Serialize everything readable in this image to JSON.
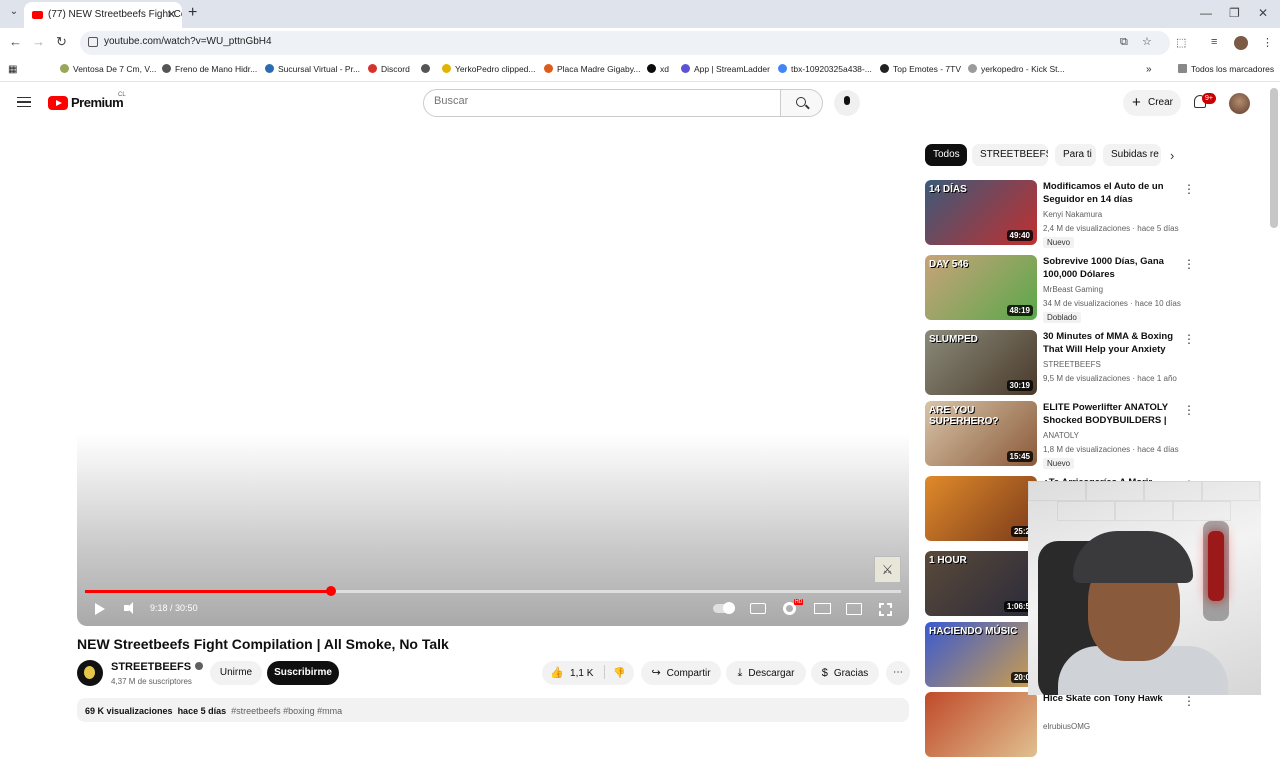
{
  "browser": {
    "tab_title": "(77) NEW Streetbeefs Fight Com",
    "url": "youtube.com/watch?v=WU_pttnGbH4",
    "bookmarks": [
      {
        "label": "Ventosa De 7 Cm, V...",
        "color": "#9aa65a"
      },
      {
        "label": "Freno de Mano Hidr...",
        "color": "#555555"
      },
      {
        "label": "Sucursal Virtual - Pr...",
        "color": "#2b6cb0"
      },
      {
        "label": "Discord",
        "color": "#d6332c"
      },
      {
        "label": "",
        "color": "#555555"
      },
      {
        "label": "YerkoPedro clipped...",
        "color": "#e0b400"
      },
      {
        "label": "Placa Madre Gigaby...",
        "color": "#e05a1c"
      },
      {
        "label": "xd",
        "color": "#0c0c0c"
      },
      {
        "label": "App | StreamLadder",
        "color": "#5b52d6"
      },
      {
        "label": "tbx-10920325a438-...",
        "color": "#4285f4"
      },
      {
        "label": "Top Emotes - 7TV",
        "color": "#222222"
      },
      {
        "label": "yerkopedro - Kick St...",
        "color": "#9b9b9b"
      }
    ],
    "all_bookmarks": "Todos los marcadores"
  },
  "header": {
    "brand": "Premium",
    "country": "CL",
    "search_placeholder": "Buscar",
    "create_label": "Crear",
    "notif_count": "9+"
  },
  "player": {
    "current_time": "9:18",
    "duration": "30:50",
    "progress": 0.302,
    "logo_glyph": "⚔"
  },
  "video": {
    "title": "NEW Streetbeefs Fight Compilation | All Smoke, No Talk",
    "channel": "STREETBEEFS",
    "subscribers": "4,37 M de suscriptores",
    "join_label": "Unirme",
    "subscribe_label": "Suscribirme",
    "likes": "1,1 K",
    "share_label": "Compartir",
    "download_label": "Descargar",
    "thanks_label": "Gracias",
    "views": "69 K visualizaciones",
    "age": "hace 5 días",
    "tags": "#streetbeefs #boxing #mma"
  },
  "chips": [
    "Todos",
    "STREETBEEFS",
    "Para ti",
    "Subidas re"
  ],
  "recommendations": [
    {
      "title": "Modificamos el Auto de un Seguidor en 14 días",
      "channel": "Kenyi Nakamura",
      "meta": "2,4 M de visualizaciones · hace 5 días",
      "tag": "Nuevo",
      "duration": "49:40",
      "badge": "14 DÍAS",
      "c1": "#3b5a7a",
      "c2": "#c22f2f"
    },
    {
      "title": "Sobrevive 1000 Días, Gana 100,000 Dólares",
      "channel": "MrBeast Gaming",
      "meta": "34 M de visualizaciones · hace 10 días",
      "tag": "Doblado",
      "duration": "48:19",
      "badge": "DAY 546",
      "c1": "#c9a27a",
      "c2": "#5aa84a"
    },
    {
      "title": "30 Minutes of MMA & Boxing That Will Help your Anxiety",
      "channel": "STREETBEEFS",
      "meta": "9,5 M de visualizaciones · hace 1 año",
      "tag": "",
      "duration": "30:19",
      "badge": "SLUMPED",
      "c1": "#8a8a7a",
      "c2": "#4a3a2a"
    },
    {
      "title": "ELITE Powerlifter ANATOLY Shocked BODYBUILDERS | ...",
      "channel": "ANATOLY",
      "meta": "1,8 M de visualizaciones · hace 4 días",
      "tag": "Nuevo",
      "duration": "15:45",
      "badge": "ARE YOU SUPERHERO?",
      "c1": "#d8c4a8",
      "c2": "#8a5a3a"
    },
    {
      "title": "¿Te Arriesgarías A Morir Por...",
      "channel": "",
      "meta": "",
      "tag": "",
      "duration": "25:2",
      "badge": "",
      "c1": "#e08a2a",
      "c2": "#7a3a1a"
    },
    {
      "title": "",
      "channel": "",
      "meta": "",
      "tag": "",
      "duration": "1:06:5",
      "badge": "1 HOUR",
      "c1": "#5a4a3a",
      "c2": "#2a2a3a"
    },
    {
      "title": "",
      "channel": "",
      "meta": "",
      "tag": "",
      "duration": "20:0",
      "badge": "HACIENDO MÚSIC",
      "c1": "#3a5ad0",
      "c2": "#d0a04a"
    },
    {
      "title": "Hice Skate con Tony Hawk",
      "channel": "elrubiusOMG",
      "meta": "",
      "tag": "",
      "duration": "",
      "badge": "",
      "c1": "#c04a2a",
      "c2": "#e0c090"
    }
  ]
}
